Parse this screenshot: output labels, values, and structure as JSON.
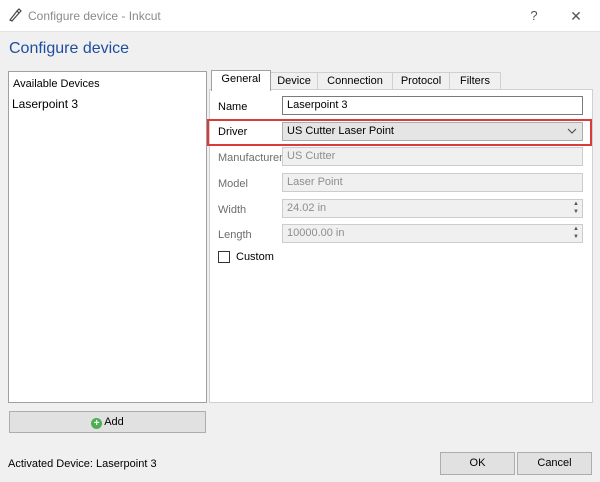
{
  "window": {
    "title": "Configure device - Inkcut",
    "help_glyph": "?",
    "close_glyph": "✕"
  },
  "heading": "Configure device",
  "devices": {
    "header": "Available Devices",
    "items": [
      "Laserpoint 3"
    ],
    "add_label": "Add"
  },
  "tabs": [
    "General",
    "Device",
    "Connection",
    "Protocol",
    "Filters"
  ],
  "active_tab": "General",
  "form": {
    "name_label": "Name",
    "name_value": "Laserpoint 3",
    "driver_label": "Driver",
    "driver_value": "US Cutter Laser Point",
    "manufacturer_label": "Manufacturer",
    "manufacturer_value": "US Cutter",
    "model_label": "Model",
    "model_value": "Laser Point",
    "width_label": "Width",
    "width_value": "24.02 in",
    "length_label": "Length",
    "length_value": "10000.00 in",
    "custom_label": "Custom",
    "custom_checked": false
  },
  "footer": {
    "status": "Activated Device: Laserpoint 3",
    "ok_label": "OK",
    "cancel_label": "Cancel"
  },
  "colors": {
    "heading": "#1f4ea0",
    "highlight": "#d93a3a"
  }
}
